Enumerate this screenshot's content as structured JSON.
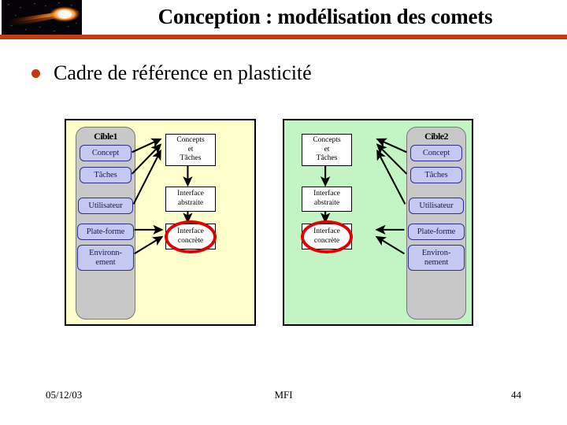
{
  "header": {
    "title": "Conception : modélisation des comets",
    "logo_icon": "comet-logo",
    "rule_color": "#bf3d10"
  },
  "bullet": {
    "icon": "bullet-dot-icon",
    "text": "Cadre de référence en plasticité",
    "dot_color": "#c0380f"
  },
  "diagram": {
    "left_panel": {
      "background": "#ffffcc",
      "title": "Cible1",
      "chips": [
        {
          "label": "Concept"
        },
        {
          "label": "Tâches"
        },
        {
          "label": "Utilisateur"
        },
        {
          "label": "Plate-forme"
        },
        {
          "label": "Environn-\nement"
        }
      ],
      "boxes": [
        {
          "lines": [
            "Concepts",
            "et",
            "Tâches"
          ]
        },
        {
          "lines": [
            "Interface",
            "abstraite"
          ]
        },
        {
          "lines": [
            "Interface",
            "concrète"
          ],
          "highlight": "red-ellipse"
        }
      ]
    },
    "right_panel": {
      "background": "#c3f4c3",
      "title": "Cible2",
      "chips": [
        {
          "label": "Concept"
        },
        {
          "label": "Tâches"
        },
        {
          "label": "Utilisateur"
        },
        {
          "label": "Plate-forme"
        },
        {
          "label": "Environ-\nnement"
        }
      ],
      "boxes": [
        {
          "lines": [
            "Concepts",
            "et",
            "Tâches"
          ]
        },
        {
          "lines": [
            "Interface",
            "abstraite"
          ]
        },
        {
          "lines": [
            "Interface",
            "concrète"
          ],
          "highlight": "red-ellipse"
        }
      ]
    },
    "highlight_color": "#e00000",
    "chip_fill": "#c5c8f0",
    "column_fill": "#c8c8c8"
  },
  "footer": {
    "date": "05/12/03",
    "center": "MFI",
    "page": "44"
  }
}
